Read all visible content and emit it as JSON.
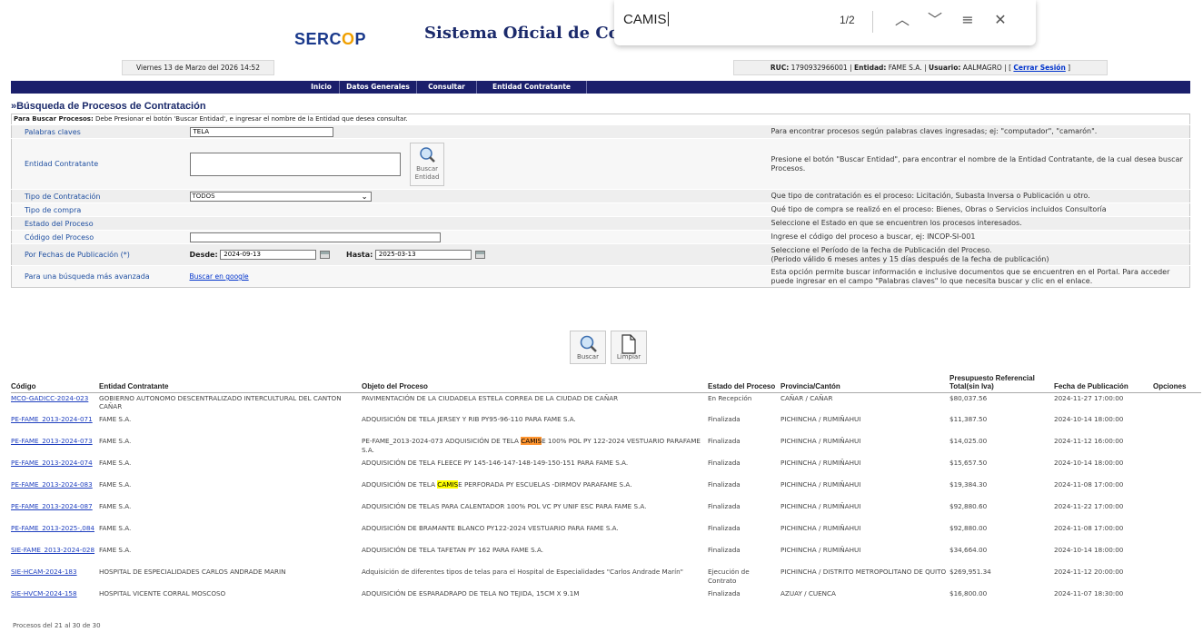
{
  "header": {
    "logo_text_a": "SERC",
    "logo_text_o": "O",
    "logo_text_b": "P",
    "site_title": "Sistema Oficial de Contra",
    "date": "Viernes 13 de Marzo del 2026 14:52",
    "ruc_label": "RUC:",
    "ruc": "1790932966001",
    "entidad_label": "Entidad:",
    "entidad": "FAME S.A.",
    "usuario_label": "Usuario:",
    "usuario": "AALMAGRO",
    "logout": "Cerrar Sesión"
  },
  "nav": [
    "Inicio",
    "Datos Generales",
    "Consultar",
    "Entidad Contratante"
  ],
  "search": {
    "title": "»Búsqueda de Procesos de Contratación",
    "hint_bold": "Para Buscar Procesos:",
    "hint_text": " Debe Presionar el botón 'Buscar Entidad', e ingresar el nombre de la Entidad que desea consultar.",
    "keywords_label": "Palabras claves",
    "keywords_value": "TELA",
    "keywords_help": "Para encontrar procesos según palabras claves ingresadas; ej: \"computador\", \"camarón\".",
    "entity_label": "Entidad Contratante",
    "entity_button_1": "Buscar",
    "entity_button_2": "Entidad",
    "entity_help": "Presione el botón \"Buscar Entidad\", para encontrar el nombre de la Entidad Contratante, de la cual desea buscar Procesos.",
    "type_label": "Tipo de Contratación",
    "type_value": "TODOS",
    "type_help": "Que tipo de contratación es el proceso: Licitación, Subasta Inversa o Publicación u otro.",
    "purchase_label": "Tipo de compra",
    "purchase_help": "Qué tipo de compra se realizó en el proceso: Bienes, Obras o Servicios incluidos Consultoría",
    "state_label": "Estado del Proceso",
    "state_help": "Seleccione el Estado en que se encuentren los procesos interesados.",
    "code_label": "Código del Proceso",
    "code_help": "Ingrese el código del proceso a buscar, ej: INCOP-SI-001",
    "dates_label": "Por Fechas de Publicación (*)",
    "from_label": "Desde:",
    "from_value": "2024-09-13",
    "to_label": "Hasta:",
    "to_value": "2025-03-13",
    "dates_help_1": "Seleccione el Período de la fecha de Publicación del Proceso.",
    "dates_help_2": "(Periodo válido 6 meses antes y 15 días después de la fecha de publicación)",
    "advanced_label": "Para una búsqueda más avanzada",
    "advanced_link": "Buscar en google",
    "advanced_help": "Esta opción permite buscar información e inclusive documentos que se encuentren en el Portal. Para acceder puede ingresar en el campo \"Palabras claves\" lo que necesita buscar y clic en el enlace.",
    "search_button": "Buscar",
    "clear_button": "Limpiar"
  },
  "results": {
    "columns": [
      "Código",
      "Entidad Contratante",
      "Objeto del Proceso",
      "Estado del Proceso",
      "Provincia/Cantón",
      "Presupuesto Referencial Total(sin Iva)",
      "Fecha de Publicación",
      "Opciones"
    ],
    "rows": [
      {
        "code": "MCO-GADICC-2024-023",
        "entity": "GOBIERNO AUTONOMO DESCENTRALIZADO INTERCULTURAL DEL CANTON CAÑAR",
        "object": "PAVIMENTACIÓN DE LA CIUDADELA ESTELA CORREA DE LA CIUDAD DE CAÑAR",
        "state": "En Recepción",
        "province": "CAÑAR / CAÑAR",
        "budget": "$80,037.56",
        "date": "2024-11-27 17:00:00"
      },
      {
        "code": "PE-FAME_2013-2024-071",
        "entity": "FAME S.A.",
        "object": "ADQUISICIÓN DE TELA JERSEY Y RIB PY95-96-110 PARA FAME S.A.",
        "state": "Finalizada",
        "province": "PICHINCHA / RUMIÑAHUI",
        "budget": "$11,387.50",
        "date": "2024-10-14 18:00:00"
      },
      {
        "code": "PE-FAME_2013-2024-073",
        "entity": "FAME S.A.",
        "object_pre": "PE-FAME_2013-2024-073 ADQUISICIÓN DE TELA ",
        "object_hl": "CAMIS",
        "object_post": "E 100% POL PY 122-2024 VESTUARIO PARAFAME S.A.",
        "hl_active": true,
        "state": "Finalizada",
        "province": "PICHINCHA / RUMIÑAHUI",
        "budget": "$14,025.00",
        "date": "2024-11-12 16:00:00"
      },
      {
        "code": "PE-FAME_2013-2024-074",
        "entity": "FAME S.A.",
        "object": "ADQUISICIÓN DE TELA FLEECE PY 145-146-147-148-149-150-151 PARA FAME S.A.",
        "state": "Finalizada",
        "province": "PICHINCHA / RUMIÑAHUI",
        "budget": "$15,657.50",
        "date": "2024-10-14 18:00:00"
      },
      {
        "code": "PE-FAME_2013-2024-083",
        "entity": "FAME S.A.",
        "object_pre": "ADQUISICIÓN DE TELA ",
        "object_hl": "CAMIS",
        "object_post": "E PERFORADA PY ESCUELAS -DIRMOV PARAFAME S.A.",
        "hl_active": false,
        "state": "Finalizada",
        "province": "PICHINCHA / RUMIÑAHUI",
        "budget": "$19,384.30",
        "date": "2024-11-08 17:00:00"
      },
      {
        "code": "PE-FAME_2013-2024-087",
        "entity": "FAME S.A.",
        "object": "ADQUISICIÓN DE TELAS PARA CALENTADOR 100% POL VC PY UNIF ESC PARA FAME S.A.",
        "state": "Finalizada",
        "province": "PICHINCHA / RUMIÑAHUI",
        "budget": "$92,880.60",
        "date": "2024-11-22 17:00:00"
      },
      {
        "code": "PE-FAME_2013-2025-,084",
        "entity": "FAME S.A.",
        "object": "ADQUISICIÓN DE BRAMANTE BLANCO PY122-2024 VESTUARIO PARA FAME S.A.",
        "state": "Finalizada",
        "province": "PICHINCHA / RUMIÑAHUI",
        "budget": "$92,880.00",
        "date": "2024-11-08 17:00:00"
      },
      {
        "code": "SIE-FAME_2013-2024-028",
        "entity": "FAME S.A.",
        "object": "ADQUISICIÓN DE TELA TAFETAN PY 162 PARA FAME S.A.",
        "state": "Finalizada",
        "province": "PICHINCHA / RUMIÑAHUI",
        "budget": "$34,664.00",
        "date": "2024-10-14 18:00:00"
      },
      {
        "code": "SIE-HCAM-2024-183",
        "entity": "HOSPITAL DE ESPECIALIDADES CARLOS ANDRADE MARIN",
        "object": "Adquisición de diferentes tipos de telas para el Hospital de Especialidades \"Carlos Andrade Marín\"",
        "state": "Ejecución de Contrato",
        "province": "PICHINCHA / DISTRITO METROPOLITANO DE QUITO",
        "budget": "$269,951.34",
        "date": "2024-11-12 20:00:00"
      },
      {
        "code": "SIE-HVCM-2024-158",
        "entity": "HOSPITAL VICENTE CORRAL MOSCOSO",
        "object": "ADQUISICIÓN DE ESPARADRAPO DE TELA NO TEJIDA, 15CM X 9.1M",
        "state": "Finalizada",
        "province": "AZUAY / CUENCA",
        "budget": "$16,800.00",
        "date": "2024-11-07 18:30:00"
      }
    ],
    "footer": "Procesos del 21 al 30 de 30"
  },
  "findbar": {
    "query": "CAMIS",
    "count": "1/2",
    "prev_icon": "chevron-up-icon",
    "next_icon": "chevron-down-icon",
    "options_icon": "filter-icon",
    "close_icon": "close-icon"
  }
}
